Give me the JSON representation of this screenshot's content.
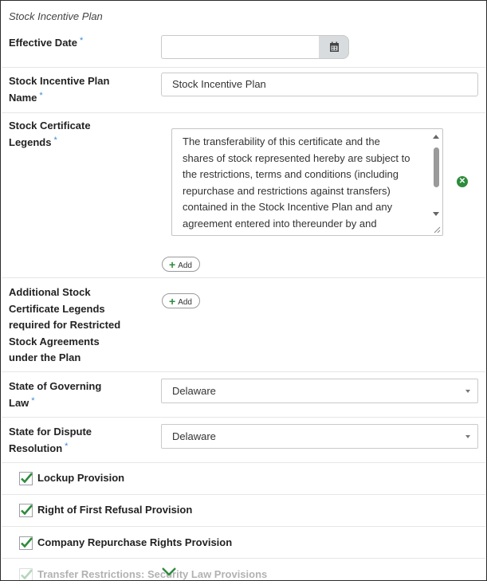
{
  "section_title": "Stock Incentive Plan",
  "required_mark": "*",
  "effective_date": {
    "label": "Effective Date",
    "value": "",
    "icon": "calendar-icon"
  },
  "plan_name": {
    "label_line1": "Stock Incentive Plan",
    "label_line2": "Name",
    "value": "Stock Incentive Plan"
  },
  "certificate_legends": {
    "label_line1": "Stock Certificate",
    "label_line2": "Legends",
    "text_lines": [
      "The transferability of this certificate and the",
      "shares of stock represented hereby are subject to",
      "the restrictions, terms and conditions (including",
      "repurchase and restrictions against transfers)",
      "contained in the Stock Incentive Plan and any",
      "agreement entered into thereunder by and"
    ],
    "add_label": "Add",
    "remove_icon": "close-circle-icon"
  },
  "additional_legends": {
    "label_lines": [
      "Additional Stock",
      "Certificate Legends",
      "required for Restricted",
      "Stock Agreements",
      "under the Plan"
    ],
    "add_label": "Add"
  },
  "governing_law": {
    "label_line1": "State of Governing",
    "label_line2": "Law",
    "value": "Delaware"
  },
  "dispute_resolution": {
    "label_line1": "State for Dispute",
    "label_line2": "Resolution",
    "value": "Delaware"
  },
  "checkboxes": [
    {
      "label": "Lockup Provision",
      "checked": true
    },
    {
      "label": "Right of First Refusal Provision",
      "checked": true
    },
    {
      "label": "Company Repurchase Rights Provision",
      "checked": true
    },
    {
      "label": "Transfer Restrictions: Security Law Provisions",
      "checked": true
    }
  ],
  "colors": {
    "accent_green": "#2e8b3d",
    "required_blue": "#3b8bd1"
  }
}
